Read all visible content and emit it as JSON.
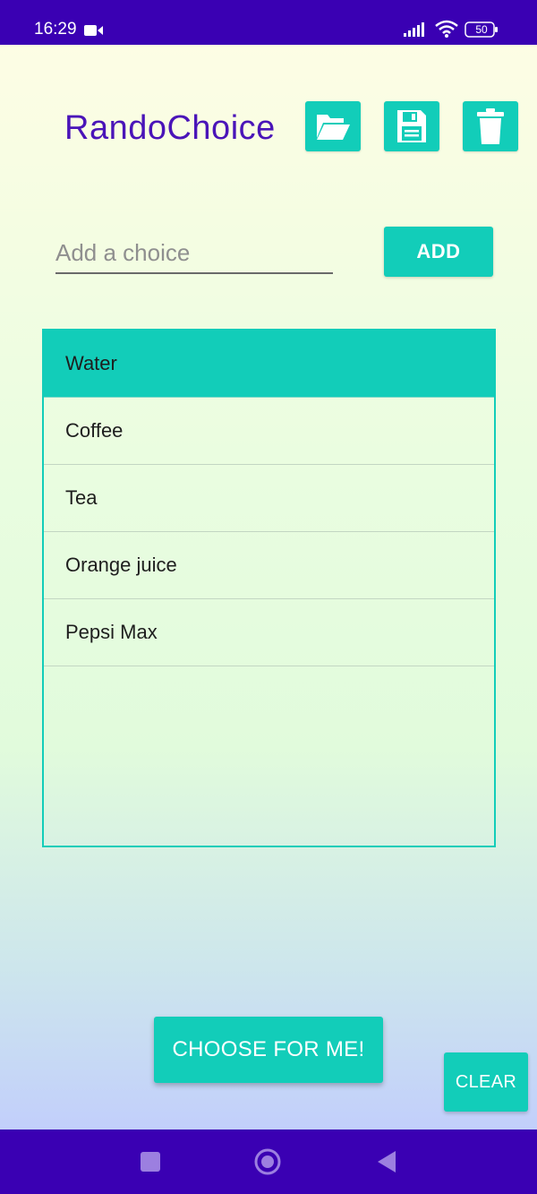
{
  "status_bar": {
    "time": "16:29",
    "battery": "50",
    "icons": [
      "video-camera-icon",
      "signal-icon",
      "wifi-icon",
      "battery-icon"
    ]
  },
  "app": {
    "title": "RandoChoice",
    "toolbar": {
      "open_icon": "folder-open-icon",
      "save_icon": "floppy-disk-icon",
      "delete_icon": "trash-icon"
    },
    "input": {
      "placeholder": "Add a choice",
      "value": ""
    },
    "add_label": "ADD",
    "choices": [
      {
        "label": "Water",
        "selected": true
      },
      {
        "label": "Coffee",
        "selected": false
      },
      {
        "label": "Tea",
        "selected": false
      },
      {
        "label": "Orange juice",
        "selected": false
      },
      {
        "label": "Pepsi Max",
        "selected": false
      }
    ],
    "choose_label": "CHOOSE FOR ME!",
    "clear_label": "CLEAR"
  },
  "colors": {
    "accent": "#12cdb9",
    "title": "#4a14b8",
    "system_bar": "#3a00b3"
  }
}
